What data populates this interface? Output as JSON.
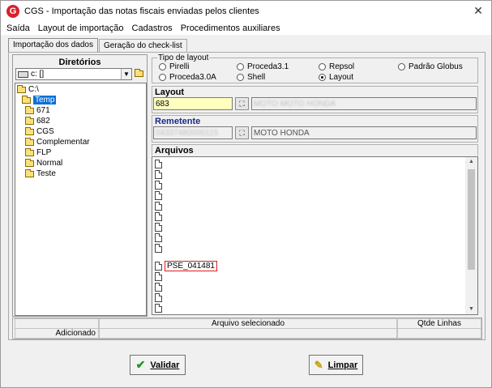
{
  "window": {
    "title": "CGS - Importação das notas fiscais enviadas pelos clientes",
    "icon": "G",
    "close_label": "✕"
  },
  "menu": [
    "Saída",
    "Layout de importação",
    "Cadastros",
    "Procedimentos auxiliares"
  ],
  "tabs": [
    "Importação dos dados",
    "Geração do check-list"
  ],
  "directories": {
    "title": "Diretórios",
    "drive": "c: []",
    "tree": [
      "C:\\",
      "Temp",
      "671",
      "682",
      "CGS",
      "Complementar",
      "FLP",
      "Normal",
      "Teste"
    ]
  },
  "layout_type": {
    "legend": "Tipo de layout",
    "options": [
      "Pirelli",
      "Proceda3.1",
      "Repsol",
      "Padrão Globus",
      "Proceda3.0A",
      "Shell",
      "Layout"
    ],
    "selected": "Layout"
  },
  "layout": {
    "label": "Layout",
    "code": "683",
    "description": "MOTO MOTO HONDA"
  },
  "sender": {
    "label": "Remetente",
    "code": "04337480000115",
    "name": "MOTO HONDA"
  },
  "files": {
    "label": "Arquivos",
    "items": [
      "",
      "",
      "",
      "",
      "",
      "",
      "",
      "",
      "",
      "PSE_041481",
      "",
      "",
      "",
      ""
    ]
  },
  "status": {
    "selected_file_header": "Arquivo selecionado",
    "qty_header": "Qtde Linhas",
    "added_label": "Adicionado"
  },
  "buttons": {
    "validate": "Validar",
    "clear": "Limpar"
  }
}
